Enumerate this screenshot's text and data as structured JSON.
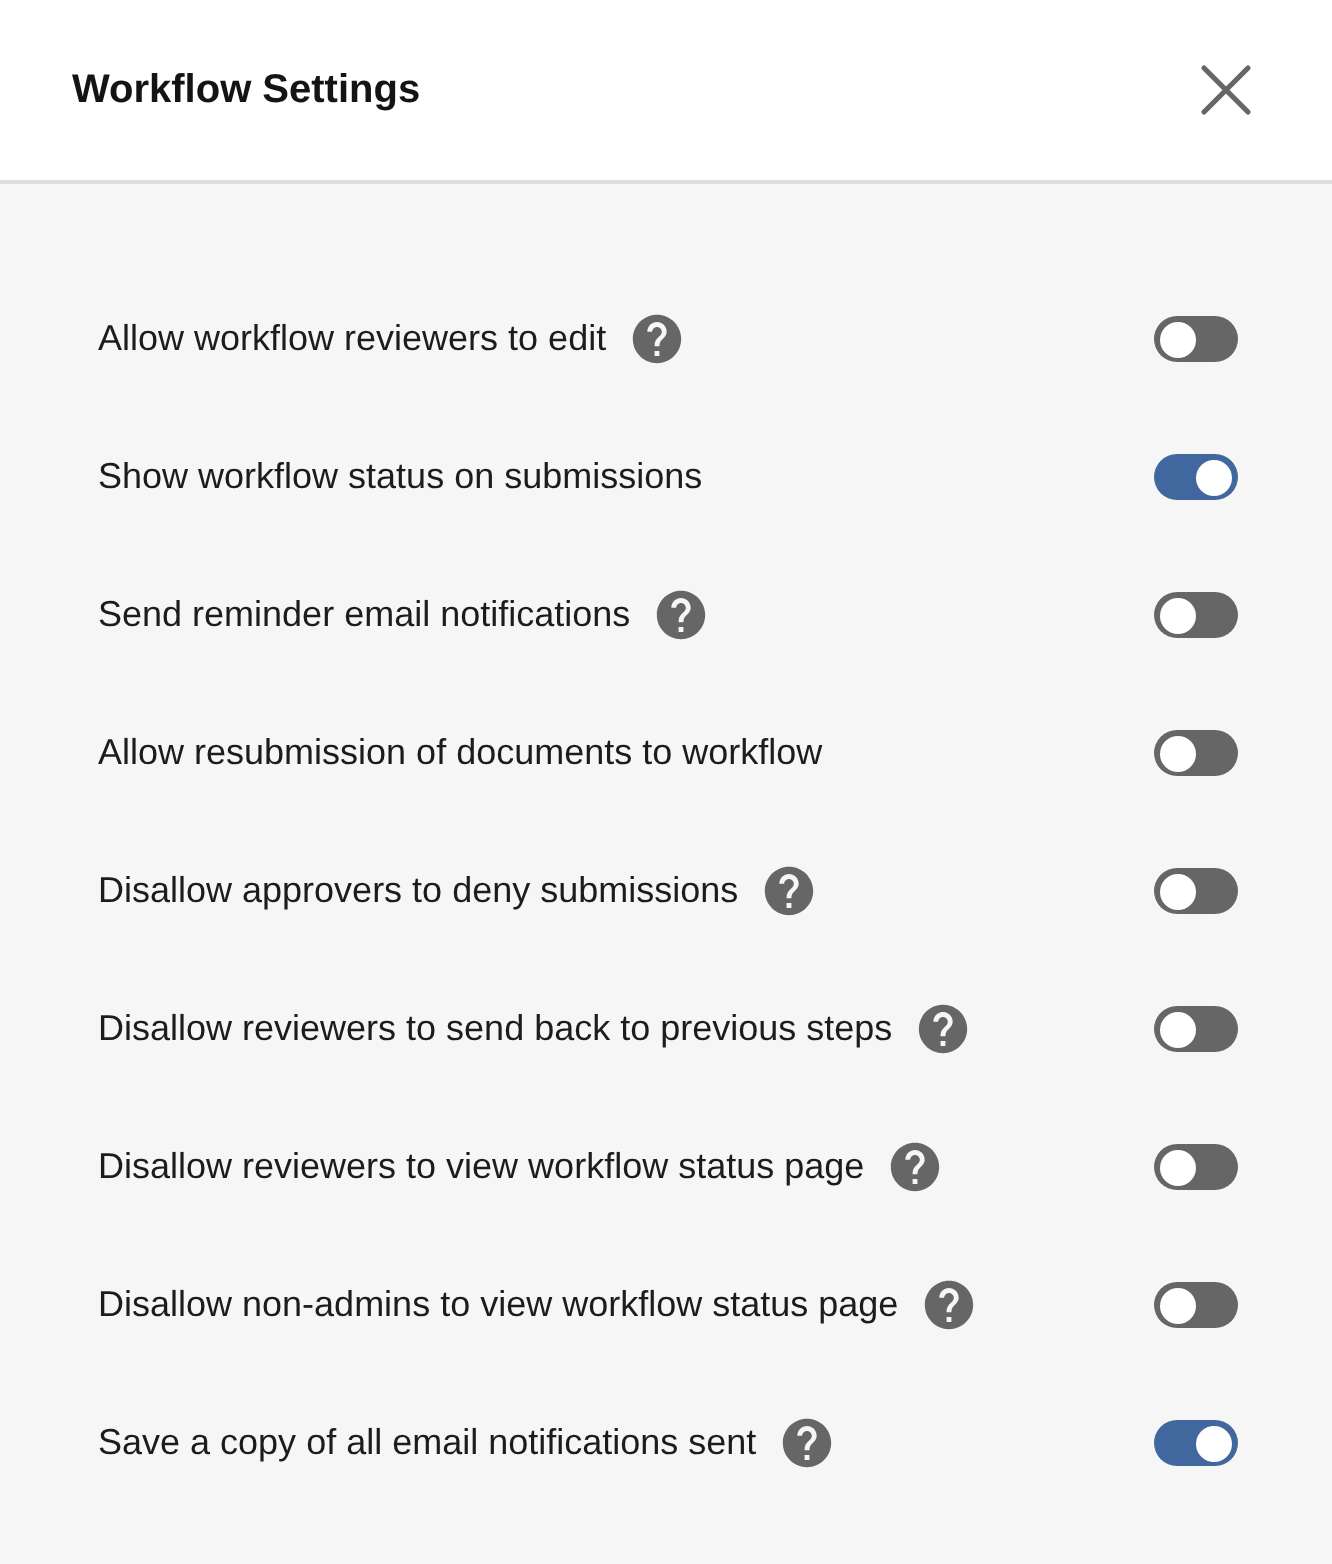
{
  "dialog": {
    "title": "Workflow Settings"
  },
  "settings": [
    {
      "label": "Allow workflow reviewers to edit",
      "help": true,
      "on": false
    },
    {
      "label": "Show workflow status on submissions",
      "help": false,
      "on": true
    },
    {
      "label": "Send reminder email notifications",
      "help": true,
      "on": false
    },
    {
      "label": "Allow resubmission of documents to workflow",
      "help": false,
      "on": false
    },
    {
      "label": "Disallow approvers to deny submissions",
      "help": true,
      "on": false
    },
    {
      "label": "Disallow reviewers to send back to previous steps",
      "help": true,
      "on": false
    },
    {
      "label": "Disallow reviewers to view workflow status page",
      "help": true,
      "on": false
    },
    {
      "label": "Disallow non-admins to view workflow status page",
      "help": true,
      "on": false
    },
    {
      "label": "Save a copy of all email notifications sent",
      "help": true,
      "on": true
    }
  ]
}
